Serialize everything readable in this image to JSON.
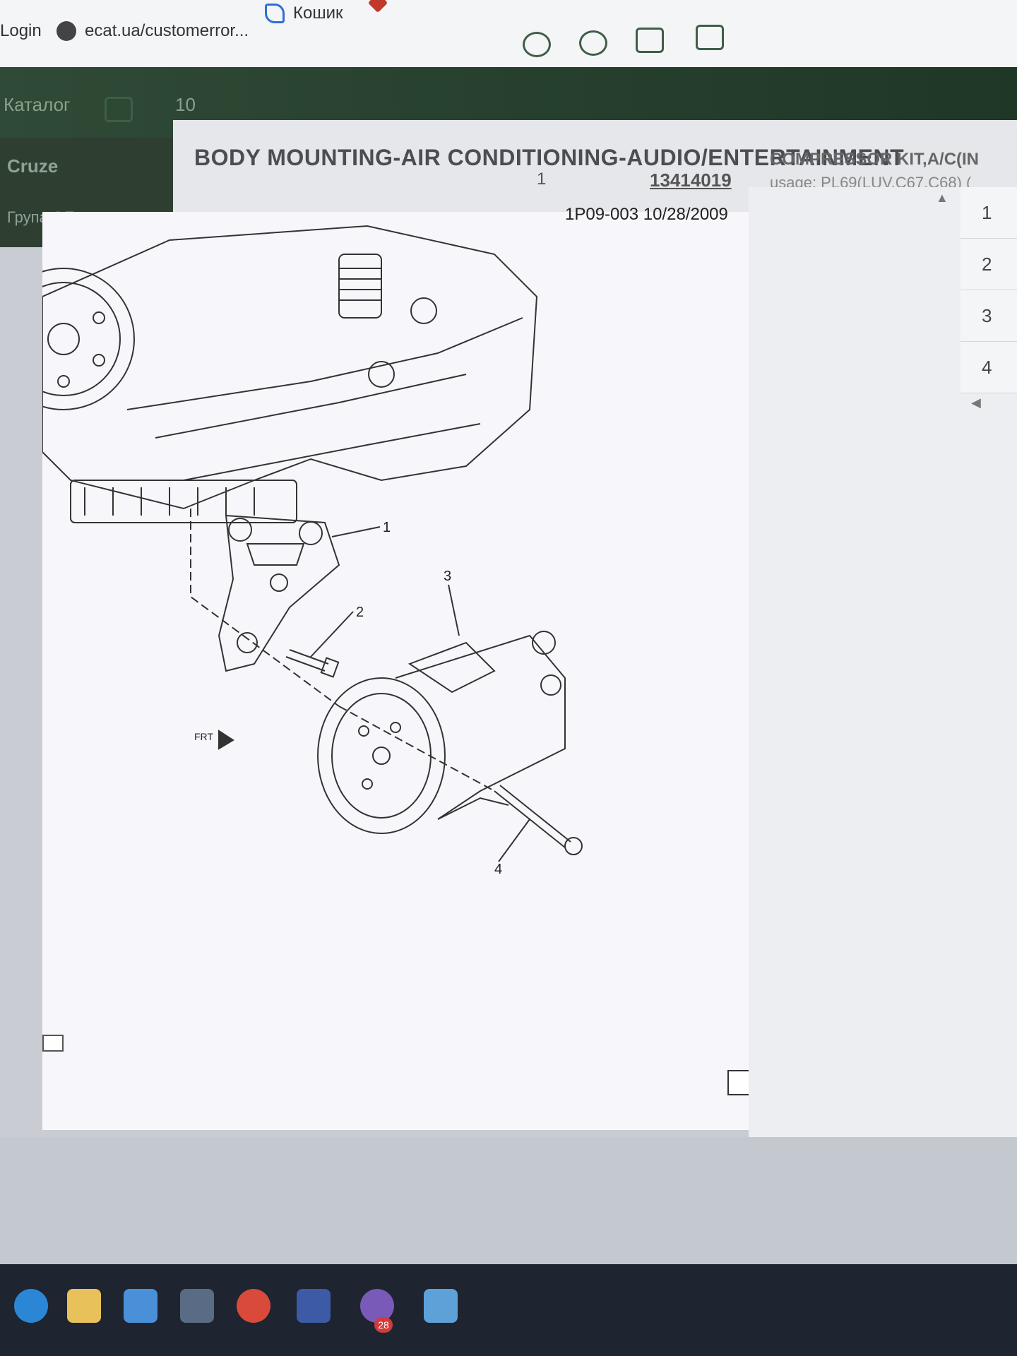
{
  "bookmarks": [
    {
      "label": "Login",
      "icon": "login-icon"
    },
    {
      "label": "ecat.ua/customerror...",
      "icon": "globe-icon"
    },
    {
      "label": "Кошик",
      "icon": "cart-icon"
    }
  ],
  "app_nav": {
    "catalog_label": "Каталог",
    "count": "10"
  },
  "sidebar": {
    "items": [
      {
        "label": "Cruze"
      },
      {
        "label": "Група OE"
      }
    ]
  },
  "content": {
    "section_title": "BODY MOUNTING-AIR CONDITIONING-AUDIO/ENTERTAINMENT",
    "part_number_index": "1",
    "part_code": "13414019",
    "part_name": "COMPRESSOR KIT,A/C(IN",
    "part_usage": "usage: PL69(LUV,C67,C68) ("
  },
  "diagram": {
    "caption": "1P09-003  10/28/2009",
    "callouts": [
      "1",
      "2",
      "3",
      "4"
    ],
    "front_label": "FRT"
  },
  "right_panel": {
    "rows": [
      {
        "label": "1"
      },
      {
        "label": "2"
      },
      {
        "label": "3"
      },
      {
        "label": "4"
      }
    ]
  },
  "taskbar": {
    "notification_count": "28"
  },
  "colors": {
    "app_bar": "#2f4a36",
    "sidebar": "#2e3f32",
    "content_bg": "#e6e7ea",
    "diagram_bg": "#f7f7fb",
    "taskbar": "#1e2430"
  }
}
